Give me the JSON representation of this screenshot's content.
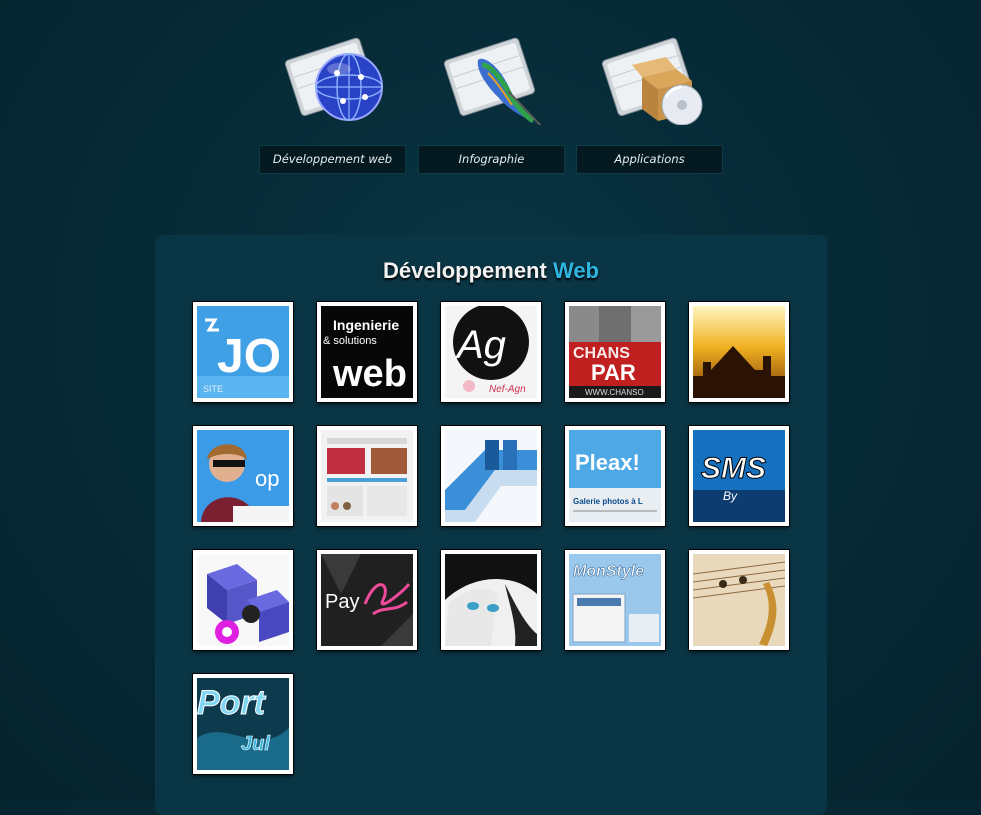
{
  "nav": {
    "items": [
      {
        "label": "Développement web",
        "icon": "globe-folder-icon"
      },
      {
        "label": "Infographie",
        "icon": "feather-folder-icon"
      },
      {
        "label": "Applications",
        "icon": "box-cd-folder-icon"
      }
    ]
  },
  "section": {
    "title_main": "Développement",
    "title_accent": "Web",
    "accent_color": "#2fb6e0"
  },
  "thumbs": [
    {
      "text": "JO",
      "sub": "SITE"
    },
    {
      "text": "Ingenierie",
      "sub": "& solutions",
      "big": "web"
    },
    {
      "text": "Ag",
      "sub": "Nef-Agn"
    },
    {
      "text": "CHANS",
      "sub": "PAR",
      "small": "WWW.CHANSO"
    },
    {
      "text": ""
    },
    {
      "text": "op"
    },
    {
      "text": ""
    },
    {
      "text": ""
    },
    {
      "text": "Pleax!",
      "sub": "Galerie photos à L"
    },
    {
      "text": "SMS",
      "sub": "By"
    },
    {
      "text": ""
    },
    {
      "text": "Pay"
    },
    {
      "text": ""
    },
    {
      "text": "MonStyle"
    },
    {
      "text": ""
    },
    {
      "text": "Port",
      "sub": "Jul"
    }
  ]
}
